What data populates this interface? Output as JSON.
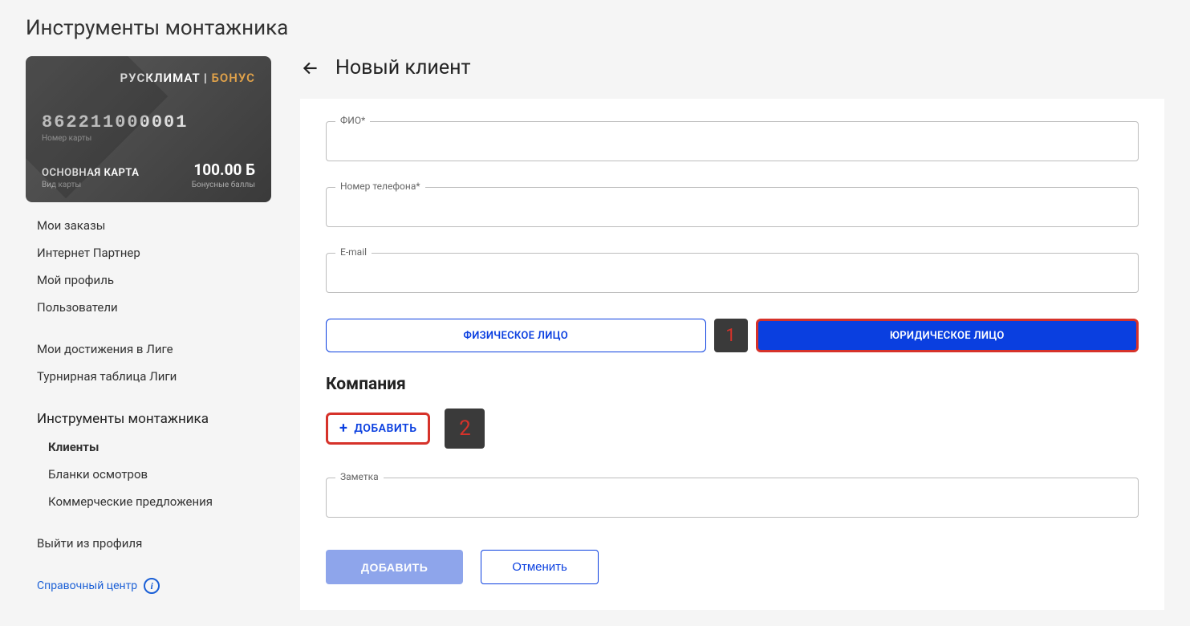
{
  "page_title": "Инструменты монтажника",
  "card": {
    "brand_main": "РУСКЛИМАТ | ",
    "brand_accent": "БОНУС",
    "number": "862211000001",
    "number_label": "Номер карты",
    "type": "ОСНОВНАЯ КАРТА",
    "type_label": "Вид карты",
    "balance": "100.00 Б",
    "balance_label": "Бонусные баллы"
  },
  "nav": {
    "group1": [
      "Мои заказы",
      "Интернет Партнер",
      "Мой профиль",
      "Пользователи"
    ],
    "group2": [
      "Мои достижения в Лиге",
      "Турнирная таблица Лиги"
    ],
    "section_header": "Инструменты монтажника",
    "subs": [
      "Клиенты",
      "Бланки осмотров",
      "Коммерческие предложения"
    ],
    "logout": "Выйти из профиля",
    "help": "Справочный центр"
  },
  "main": {
    "title": "Новый клиент",
    "fields": {
      "fio_label": "ФИО*",
      "phone_label": "Номер телефона*",
      "email_label": "E-mail",
      "note_label": "Заметка"
    },
    "toggle": {
      "individual": "ФИЗИЧЕСКОЕ ЛИЦО",
      "legal": "ЮРИДИЧЕСКОЕ ЛИЦО"
    },
    "company_title": "Компания",
    "add_button": "ДОБАВИТЬ",
    "submit": "ДОБАВИТЬ",
    "cancel": "Отменить",
    "annotations": {
      "step1": "1",
      "step2": "2"
    }
  }
}
